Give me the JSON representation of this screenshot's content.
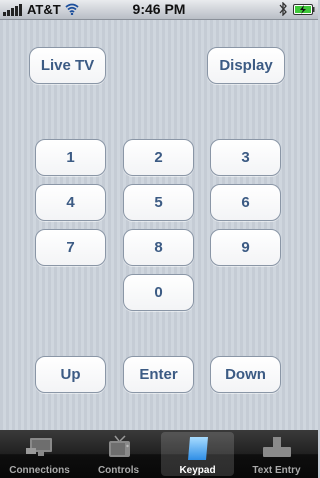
{
  "status_bar": {
    "carrier": "AT&T",
    "time": "9:46 PM"
  },
  "top_buttons": {
    "live_tv": "Live TV",
    "display": "Display"
  },
  "keypad": {
    "keys": [
      "1",
      "2",
      "3",
      "4",
      "5",
      "6",
      "7",
      "8",
      "9",
      "0"
    ]
  },
  "nav_buttons": {
    "up": "Up",
    "enter": "Enter",
    "down": "Down"
  },
  "tab_bar": {
    "tabs": [
      {
        "label": "Connections",
        "icon": "connections-icon"
      },
      {
        "label": "Controls",
        "icon": "tv-icon"
      },
      {
        "label": "Keypad",
        "icon": "keypad-icon"
      },
      {
        "label": "Text Entry",
        "icon": "text-entry-icon"
      }
    ],
    "active_tab": "Keypad"
  },
  "colors": {
    "button_text": "#3c5b84",
    "background": "#c9d0d8",
    "battery_green": "#3fc83a"
  }
}
